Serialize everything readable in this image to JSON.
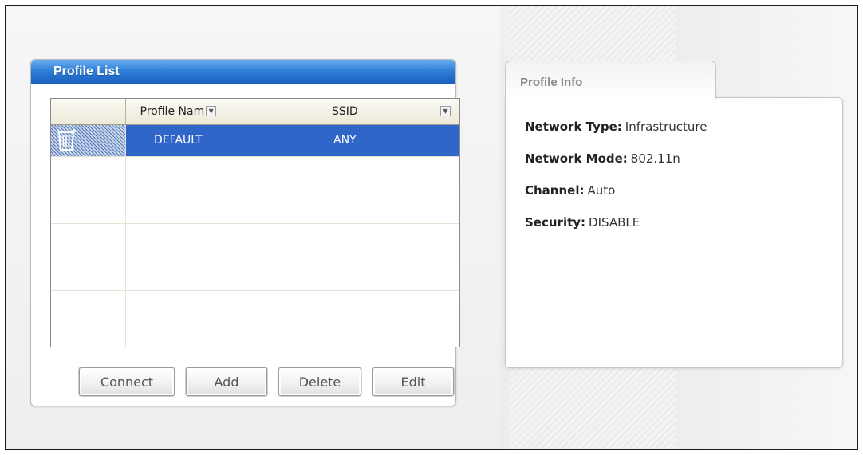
{
  "profile_list": {
    "title": "Profile List",
    "columns": {
      "profile_name": "Profile Nam",
      "ssid": "SSID"
    },
    "rows": [
      {
        "profile_name": "DEFAULT",
        "ssid": "ANY",
        "selected": true
      }
    ],
    "buttons": {
      "connect": "Connect",
      "add": "Add",
      "delete": "Delete",
      "edit": "Edit"
    }
  },
  "profile_info": {
    "tab_label": "Profile Info",
    "network_type_label": "Network Type:",
    "network_type_value": "Infrastructure",
    "network_mode_label": "Network Mode:",
    "network_mode_value": "802.11n",
    "channel_label": "Channel:",
    "channel_value": "Auto",
    "security_label": "Security:",
    "security_value": "DISABLE"
  },
  "colors": {
    "header_blue": "#2f7fd8",
    "selection_blue": "#2f66c7"
  },
  "icons": {
    "row_icon": "trash-icon",
    "column_dropdown": "dropdown-icon"
  }
}
